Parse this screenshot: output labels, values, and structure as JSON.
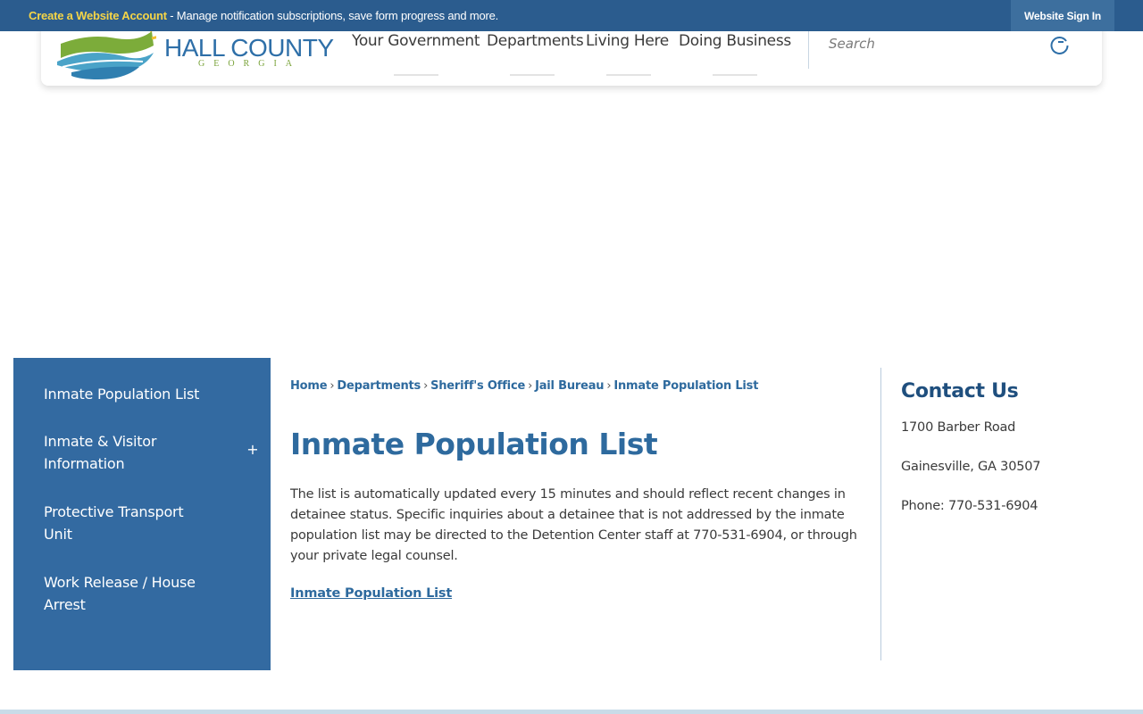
{
  "topbar": {
    "create_account_link": "Create a Website Account",
    "message": " - Manage notification subscriptions, save form progress and more.",
    "signin_label": "Website Sign In"
  },
  "header": {
    "logo_title": "HALL COUNTY",
    "logo_subtitle": "GEORGIA",
    "nav": [
      {
        "label": "Your Government"
      },
      {
        "label": "Departments"
      },
      {
        "label": "Living Here"
      },
      {
        "label": "Doing Business"
      }
    ],
    "search_placeholder": "Search",
    "search_icon": "search-icon"
  },
  "sidebar": {
    "items": [
      {
        "label": "Inmate Population List"
      },
      {
        "label": "Inmate & Visitor Information",
        "expandable": true,
        "toggle": "+"
      },
      {
        "label": "Protective Transport Unit"
      },
      {
        "label": "Work Release / House Arrest"
      }
    ]
  },
  "breadcrumb": {
    "items": [
      "Home",
      "Departments",
      "Sheriff's Office",
      "Jail Bureau"
    ],
    "current": "Inmate Population List",
    "separator": "›"
  },
  "main": {
    "title": "Inmate Population List",
    "description": "The list is automatically updated every 15 minutes and should reflect recent changes in detainee status. Specific inquiries about a detainee that is not addressed by the inmate population list may be directed to the Detention Center staff at 770-531-6904, or through your private legal counsel.",
    "link_label": "Inmate Population List"
  },
  "contact": {
    "title": "Contact Us",
    "address1": "1700 Barber Road",
    "address2": "Gainesville, GA 30507",
    "phone": "Phone: 770-531-6904"
  },
  "colors": {
    "topbar": "#2b5c8e",
    "accent_yellow": "#f5d547",
    "sidebar": "#336aa1",
    "link_blue": "#2e6a9e",
    "heading_dark": "#1f4f7e"
  }
}
